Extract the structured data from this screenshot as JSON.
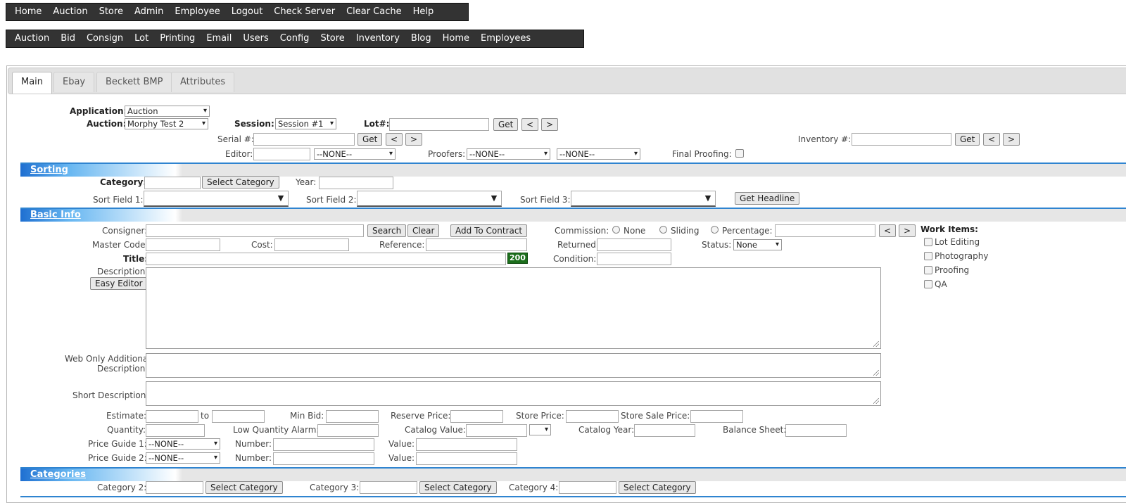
{
  "top_nav": [
    "Home",
    "Auction",
    "Store",
    "Admin",
    "Employee",
    "Logout",
    "Check Server",
    "Clear Cache",
    "Help"
  ],
  "sub_nav": [
    "Auction",
    "Bid",
    "Consign",
    "Lot",
    "Printing",
    "Email",
    "Users",
    "Config",
    "Store",
    "Inventory",
    "Blog",
    "Home",
    "Employees"
  ],
  "tabs": [
    "Main",
    "Ebay",
    "Beckett BMP",
    "Attributes"
  ],
  "header": {
    "application_label": "Application:",
    "application_value": "Auction",
    "auction_label": "Auction:",
    "auction_value": "Morphy Test 2",
    "session_label": "Session:",
    "session_value": "Session #1",
    "lot_label": "Lot#:",
    "get_label": "Get",
    "prev_label": "<",
    "next_label": ">",
    "serial_label": "Serial #:",
    "inventory_label": "Inventory #:",
    "editor_label": "Editor:",
    "editor_select": "--NONE--",
    "proofers_label": "Proofers:",
    "proofer1": "--NONE--",
    "proofer2": "--NONE--",
    "final_proofing_label": "Final Proofing:"
  },
  "sorting": {
    "title": "Sorting",
    "category_label": "Category:",
    "select_category": "Select Category",
    "year_label": "Year:",
    "sort1_label": "Sort Field 1:",
    "sort2_label": "Sort Field 2:",
    "sort3_label": "Sort Field 3:",
    "get_headline": "Get Headline"
  },
  "basic": {
    "title": "Basic Info",
    "consigner_label": "Consigner:",
    "search": "Search",
    "clear": "Clear",
    "add_to_contract": "Add To Contract",
    "commission_label": "Commission:",
    "comm_none": "None",
    "comm_sliding": "Sliding",
    "comm_percentage": "Percentage:",
    "master_code_label": "Master Code:",
    "cost_label": "Cost:",
    "reference_label": "Reference:",
    "returned_label": "Returned:",
    "status_label": "Status:",
    "status_value": "None",
    "title_label": "Title:",
    "title_counter": "200",
    "condition_label": "Condition:",
    "description_label": "Description:",
    "easy_editor": "Easy Editor",
    "web_only_1": "Web Only Additional",
    "web_only_2": "Description:",
    "short_desc_label": "Short Description:",
    "estimate_label": "Estimate:",
    "to_label": "to",
    "min_bid_label": "Min Bid:",
    "reserve_label": "Reserve Price:",
    "store_price_label": "Store Price:",
    "store_sale_label": "Store Sale Price:",
    "quantity_label": "Quantity:",
    "low_qty_label": "Low Quantity Alarm:",
    "catalog_value_label": "Catalog Value:",
    "catalog_year_label": "Catalog Year:",
    "balance_sheet_label": "Balance Sheet:",
    "pg1_label": "Price Guide 1:",
    "pg2_label": "Price Guide 2:",
    "pg_value": "--NONE--",
    "number_label": "Number:",
    "value_label": "Value:"
  },
  "work_items": {
    "title": "Work Items:",
    "items": [
      "Lot Editing",
      "Photography",
      "Proofing",
      "QA"
    ]
  },
  "categories": {
    "title": "Categories",
    "cat2_label": "Category 2:",
    "cat3_label": "Category 3:",
    "cat4_label": "Category 4:",
    "select_category": "Select Category"
  }
}
